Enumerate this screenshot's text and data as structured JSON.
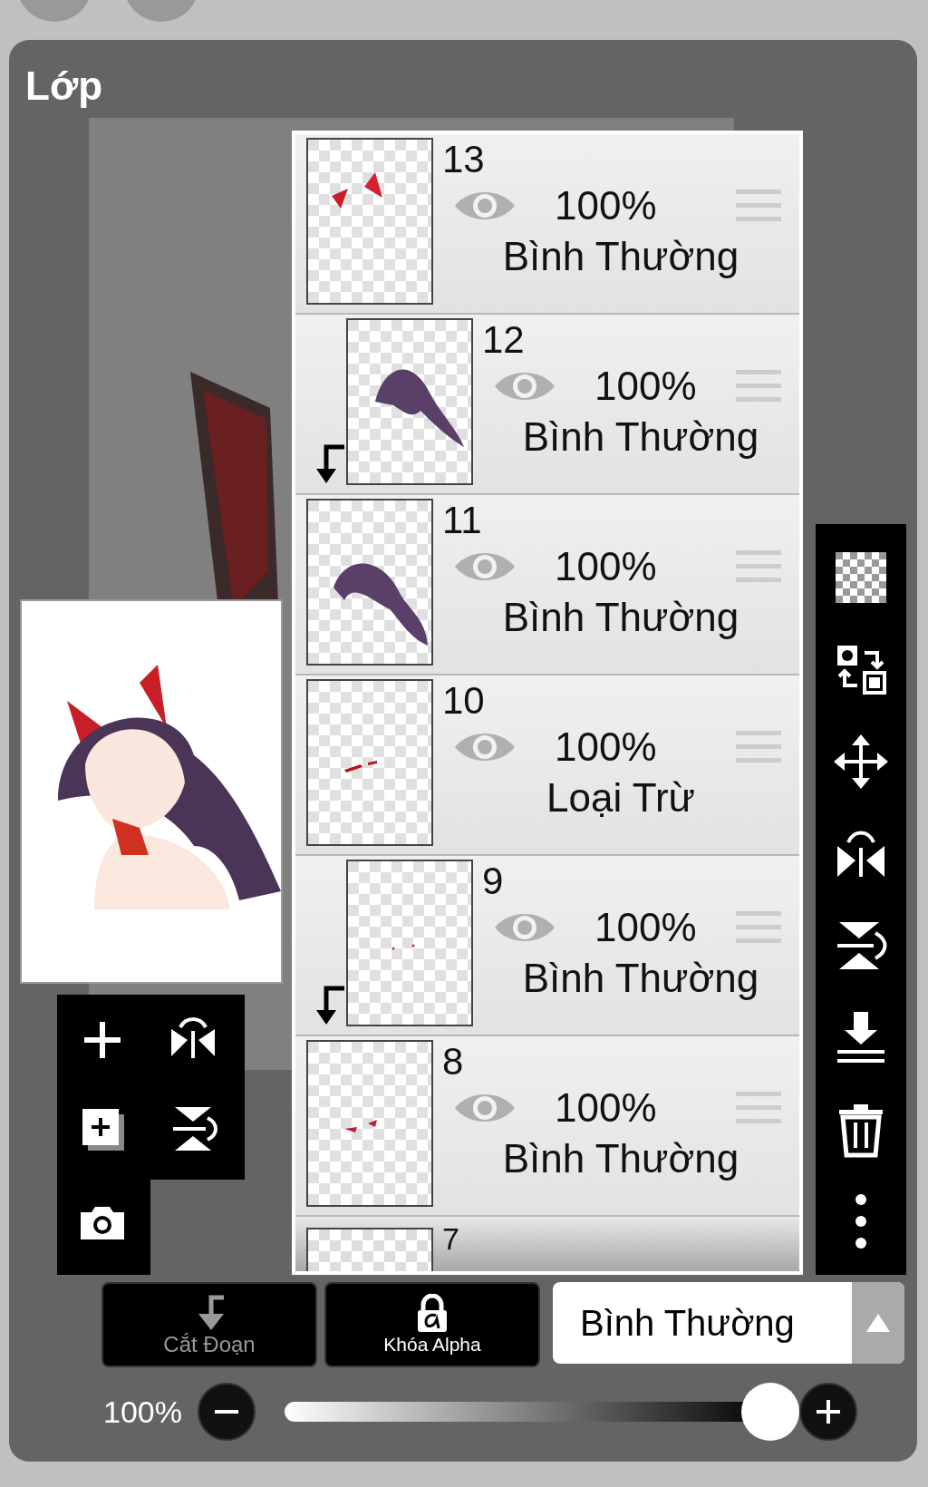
{
  "panel": {
    "title": "Lớp"
  },
  "layers": [
    {
      "number": "13",
      "visible": true,
      "opacity": "100%",
      "blend_mode": "Bình Thường",
      "clipped": false
    },
    {
      "number": "12",
      "visible": true,
      "opacity": "100%",
      "blend_mode": "Bình Thường",
      "clipped": true
    },
    {
      "number": "11",
      "visible": true,
      "opacity": "100%",
      "blend_mode": "Bình Thường",
      "clipped": false
    },
    {
      "number": "10",
      "visible": true,
      "opacity": "100%",
      "blend_mode": "Loại Trừ",
      "clipped": false
    },
    {
      "number": "9",
      "visible": true,
      "opacity": "100%",
      "blend_mode": "Bình Thường",
      "clipped": true
    },
    {
      "number": "8",
      "visible": true,
      "opacity": "100%",
      "blend_mode": "Bình Thường",
      "clipped": false
    }
  ],
  "next_layer": {
    "number": "7"
  },
  "buttons": [
    {
      "label": "Cắt Đoạn",
      "kind": "clipping",
      "disabled": true
    },
    {
      "label": "Khóa Alpha",
      "kind": "alpha-lock",
      "disabled": false
    }
  ],
  "blend_select": {
    "value": "Bình Thường"
  },
  "opacity": {
    "reading": "100%",
    "level": 1
  }
}
